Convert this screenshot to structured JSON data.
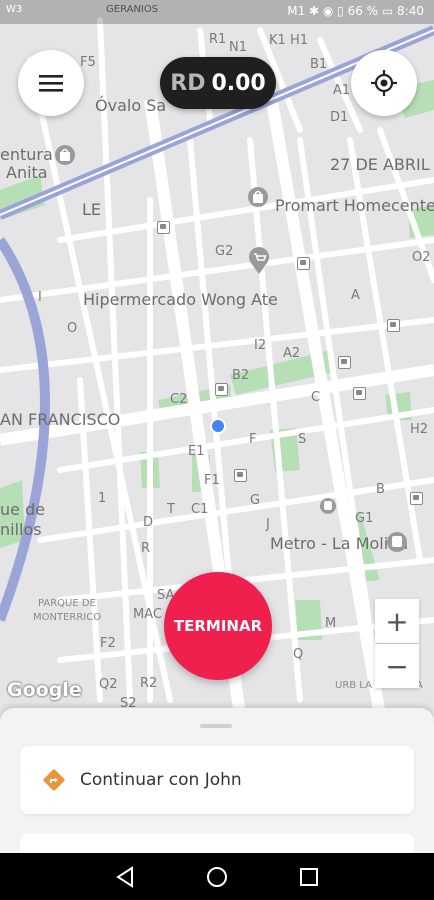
{
  "status": {
    "carrier": "W3",
    "right": "M1 ✱ ◉ ▯ 66 % ▭ 8:40"
  },
  "map": {
    "labels": [
      {
        "t": "GERANIOS",
        "c": "small"
      },
      {
        "t": "R1",
        "c": ""
      },
      {
        "t": "N1",
        "c": ""
      },
      {
        "t": "K1",
        "c": ""
      },
      {
        "t": "H1",
        "c": ""
      },
      {
        "t": "F5",
        "c": ""
      },
      {
        "t": "B1",
        "c": ""
      },
      {
        "t": "A1",
        "c": ""
      },
      {
        "t": "D1",
        "c": ""
      },
      {
        "t": "Óvalo Sa",
        "c": "big"
      },
      {
        "t": "entura",
        "c": "big"
      },
      {
        "t": "Anita",
        "c": "big"
      },
      {
        "t": "27 DE ABRIL",
        "c": "big"
      },
      {
        "t": "LE",
        "c": "big"
      },
      {
        "t": "Promart Homecenter",
        "c": "big"
      },
      {
        "t": "G2",
        "c": ""
      },
      {
        "t": "O2",
        "c": ""
      },
      {
        "t": "Hipermercado Wong Ate",
        "c": "big"
      },
      {
        "t": "A",
        "c": ""
      },
      {
        "t": "I",
        "c": ""
      },
      {
        "t": "O",
        "c": ""
      },
      {
        "t": "I2",
        "c": ""
      },
      {
        "t": "A2",
        "c": ""
      },
      {
        "t": "B2",
        "c": ""
      },
      {
        "t": "C2",
        "c": ""
      },
      {
        "t": "C",
        "c": ""
      },
      {
        "t": "AN FRANCISCO",
        "c": "big"
      },
      {
        "t": "F",
        "c": ""
      },
      {
        "t": "S",
        "c": ""
      },
      {
        "t": "H2",
        "c": ""
      },
      {
        "t": "E1",
        "c": ""
      },
      {
        "t": "F1",
        "c": ""
      },
      {
        "t": "B",
        "c": ""
      },
      {
        "t": "1",
        "c": ""
      },
      {
        "t": "G",
        "c": ""
      },
      {
        "t": "T",
        "c": ""
      },
      {
        "t": "C1",
        "c": ""
      },
      {
        "t": "G1",
        "c": ""
      },
      {
        "t": "ue de",
        "c": "big"
      },
      {
        "t": "nillos",
        "c": "big"
      },
      {
        "t": "D",
        "c": ""
      },
      {
        "t": "J",
        "c": ""
      },
      {
        "t": "Metro - La Molina",
        "c": "big"
      },
      {
        "t": "R",
        "c": ""
      },
      {
        "t": "PARQUE DE",
        "c": "small"
      },
      {
        "t": "MONTERRICO",
        "c": "small"
      },
      {
        "t": "SA",
        "c": ""
      },
      {
        "t": "MAC",
        "c": ""
      },
      {
        "t": "M",
        "c": ""
      },
      {
        "t": "F2",
        "c": ""
      },
      {
        "t": "Q",
        "c": ""
      },
      {
        "t": "Q2",
        "c": ""
      },
      {
        "t": "R2",
        "c": ""
      },
      {
        "t": "S2",
        "c": ""
      },
      {
        "t": "URB LA FONTANA",
        "c": "small"
      }
    ]
  },
  "fare": {
    "currency": "RD",
    "amount": "0.00"
  },
  "terminar_label": "TERMINAR",
  "zoom": {
    "in": "+",
    "out": "−"
  },
  "google_logo": "Google",
  "sheet": {
    "continue_label": "Continuar con John"
  },
  "icons": {
    "menu": "menu-icon",
    "locate": "my-location-icon",
    "turn": "turn-right-icon",
    "back": "back-icon",
    "home": "home-icon",
    "recents": "recents-icon"
  },
  "colors": {
    "accent": "#ef1f4e",
    "route": "#9aa4d6",
    "park": "#a9d8a9",
    "turn_icon": "#e8943a"
  }
}
